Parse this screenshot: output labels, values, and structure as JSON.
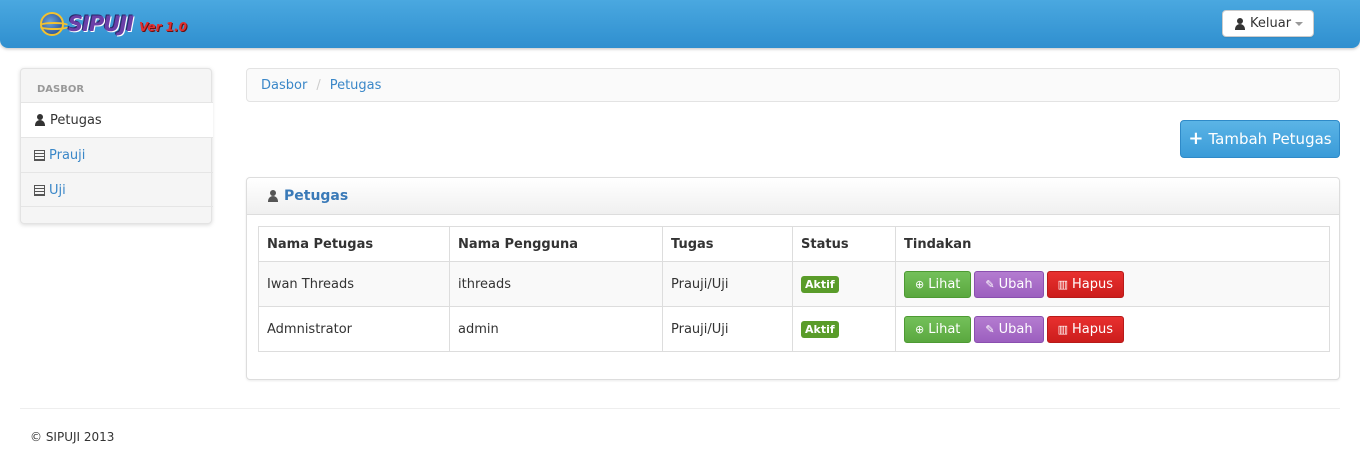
{
  "navbar": {
    "brand_text": "SIPUJI",
    "brand_version": "Ver 1.0",
    "user_button_label": "Keluar"
  },
  "sidebar": {
    "header": "DASBOR",
    "items": [
      {
        "label": "Petugas",
        "icon": "user-icon",
        "active": true
      },
      {
        "label": "Prauji",
        "icon": "list-icon",
        "active": false
      },
      {
        "label": "Uji",
        "icon": "list-icon",
        "active": false
      }
    ]
  },
  "breadcrumb": {
    "items": [
      "Dasbor",
      "Petugas"
    ],
    "separator": "/"
  },
  "add_button_label": "Tambah Petugas",
  "panel": {
    "title": "Petugas",
    "columns": [
      "Nama Petugas",
      "Nama Pengguna",
      "Tugas",
      "Status",
      "Tindakan"
    ],
    "rows": [
      {
        "nama": "Iwan Threads",
        "pengguna": "ithreads",
        "tugas": "Prauji/Uji",
        "status": "Aktif"
      },
      {
        "nama": "Admnistrator",
        "pengguna": "admin",
        "tugas": "Prauji/Uji",
        "status": "Aktif"
      }
    ],
    "actions": {
      "view": "Lihat",
      "edit": "Ubah",
      "delete": "Hapus"
    }
  },
  "footer": "© SIPUJI 2013",
  "colors": {
    "navbar": "#3a9bd8",
    "link": "#3a87c8",
    "status_active": "#5a9c2a",
    "view_button": "#5aa83f",
    "edit_button": "#9c5fbf",
    "delete_button": "#cc1d1c"
  }
}
